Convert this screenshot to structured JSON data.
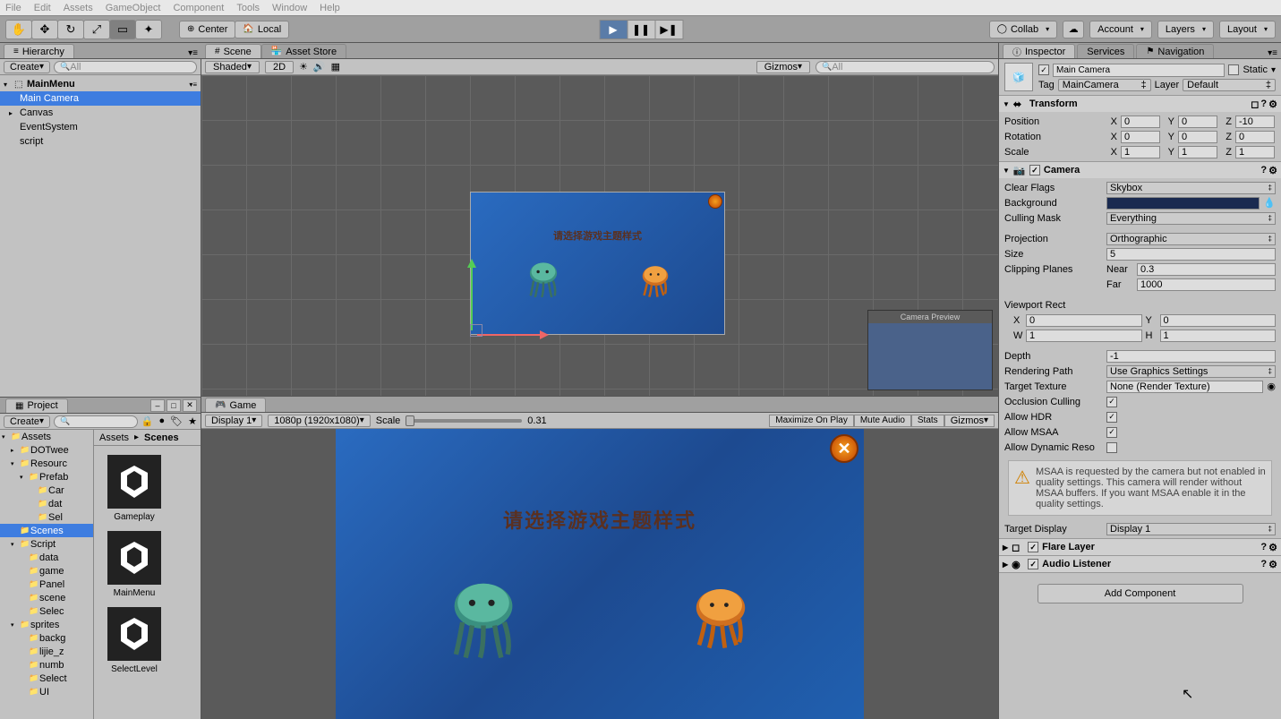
{
  "menubar": [
    "File",
    "Edit",
    "Assets",
    "GameObject",
    "Component",
    "Tools",
    "Window",
    "Help"
  ],
  "toolbar": {
    "pivot_center": "Center",
    "pivot_local": "Local",
    "collab": "Collab",
    "account": "Account",
    "layers": "Layers",
    "layout": "Layout"
  },
  "hierarchy": {
    "tab": "Hierarchy",
    "create": "Create",
    "search_ph": "All",
    "scene": "MainMenu",
    "items": [
      "Main Camera",
      "Canvas",
      "EventSystem",
      "script"
    ],
    "selected": 0,
    "expandable": [
      false,
      true,
      false,
      false
    ]
  },
  "scene": {
    "tab_scene": "Scene",
    "tab_asset": "Asset Store",
    "shading": "Shaded",
    "mode_2d": "2D",
    "gizmos": "Gizmos",
    "search_ph": "All",
    "canvas_title": "请选择游戏主题样式",
    "cam_preview": "Camera Preview"
  },
  "game": {
    "tab": "Game",
    "display": "Display 1",
    "resolution": "1080p (1920x1080)",
    "scale_label": "Scale",
    "scale_value": "0.31",
    "maximize": "Maximize On Play",
    "mute": "Mute Audio",
    "stats": "Stats",
    "gizmos": "Gizmos",
    "title": "请选择游戏主题样式"
  },
  "project": {
    "tab": "Project",
    "create": "Create",
    "search_ph": "",
    "breadcrumb": [
      "Assets",
      "Scenes"
    ],
    "tree": [
      {
        "name": "Assets",
        "depth": 0,
        "exp": "▾"
      },
      {
        "name": "DOTwee",
        "depth": 1,
        "exp": "▸"
      },
      {
        "name": "Resourc",
        "depth": 1,
        "exp": "▾"
      },
      {
        "name": "Prefab",
        "depth": 2,
        "exp": "▾"
      },
      {
        "name": "Car",
        "depth": 3,
        "exp": ""
      },
      {
        "name": "dat",
        "depth": 3,
        "exp": ""
      },
      {
        "name": "Sel",
        "depth": 3,
        "exp": ""
      },
      {
        "name": "Scenes",
        "depth": 1,
        "exp": "",
        "sel": true
      },
      {
        "name": "Script",
        "depth": 1,
        "exp": "▾"
      },
      {
        "name": "data",
        "depth": 2,
        "exp": ""
      },
      {
        "name": "game",
        "depth": 2,
        "exp": ""
      },
      {
        "name": "Panel",
        "depth": 2,
        "exp": ""
      },
      {
        "name": "scene",
        "depth": 2,
        "exp": ""
      },
      {
        "name": "Selec",
        "depth": 2,
        "exp": ""
      },
      {
        "name": "sprites",
        "depth": 1,
        "exp": "▾"
      },
      {
        "name": "backg",
        "depth": 2,
        "exp": ""
      },
      {
        "name": "lijie_z",
        "depth": 2,
        "exp": ""
      },
      {
        "name": "numb",
        "depth": 2,
        "exp": ""
      },
      {
        "name": "Select",
        "depth": 2,
        "exp": ""
      },
      {
        "name": "UI",
        "depth": 2,
        "exp": ""
      }
    ],
    "items": [
      "Gameplay",
      "MainMenu",
      "SelectLevel"
    ]
  },
  "inspector": {
    "tab_inspector": "Inspector",
    "tab_services": "Services",
    "tab_nav": "Navigation",
    "name": "Main Camera",
    "static": "Static",
    "tag_label": "Tag",
    "tag_value": "MainCamera",
    "layer_label": "Layer",
    "layer_value": "Default",
    "transform": {
      "title": "Transform",
      "pos": "Position",
      "rot": "Rotation",
      "scl": "Scale",
      "px": "0",
      "py": "0",
      "pz": "-10",
      "rx": "0",
      "ry": "0",
      "rz": "0",
      "sx": "1",
      "sy": "1",
      "sz": "1"
    },
    "camera": {
      "title": "Camera",
      "clear_flags_l": "Clear Flags",
      "clear_flags_v": "Skybox",
      "background_l": "Background",
      "culling_l": "Culling Mask",
      "culling_v": "Everything",
      "projection_l": "Projection",
      "projection_v": "Orthographic",
      "size_l": "Size",
      "size_v": "5",
      "clip_l": "Clipping Planes",
      "near_l": "Near",
      "near_v": "0.3",
      "far_l": "Far",
      "far_v": "1000",
      "vrect_l": "Viewport Rect",
      "vx": "0",
      "vy": "0",
      "vw": "1",
      "vh": "1",
      "depth_l": "Depth",
      "depth_v": "-1",
      "render_l": "Rendering Path",
      "render_v": "Use Graphics Settings",
      "target_l": "Target Texture",
      "target_v": "None (Render Texture)",
      "occ_l": "Occlusion Culling",
      "hdr_l": "Allow HDR",
      "msaa_l": "Allow MSAA",
      "dyn_l": "Allow Dynamic Reso",
      "warn": "MSAA is requested by the camera but not enabled in quality settings. This camera will render without MSAA buffers. If you want MSAA enable it in the quality settings.",
      "tdisp_l": "Target Display",
      "tdisp_v": "Display 1"
    },
    "flare": "Flare Layer",
    "audio": "Audio Listener",
    "add": "Add Component"
  }
}
